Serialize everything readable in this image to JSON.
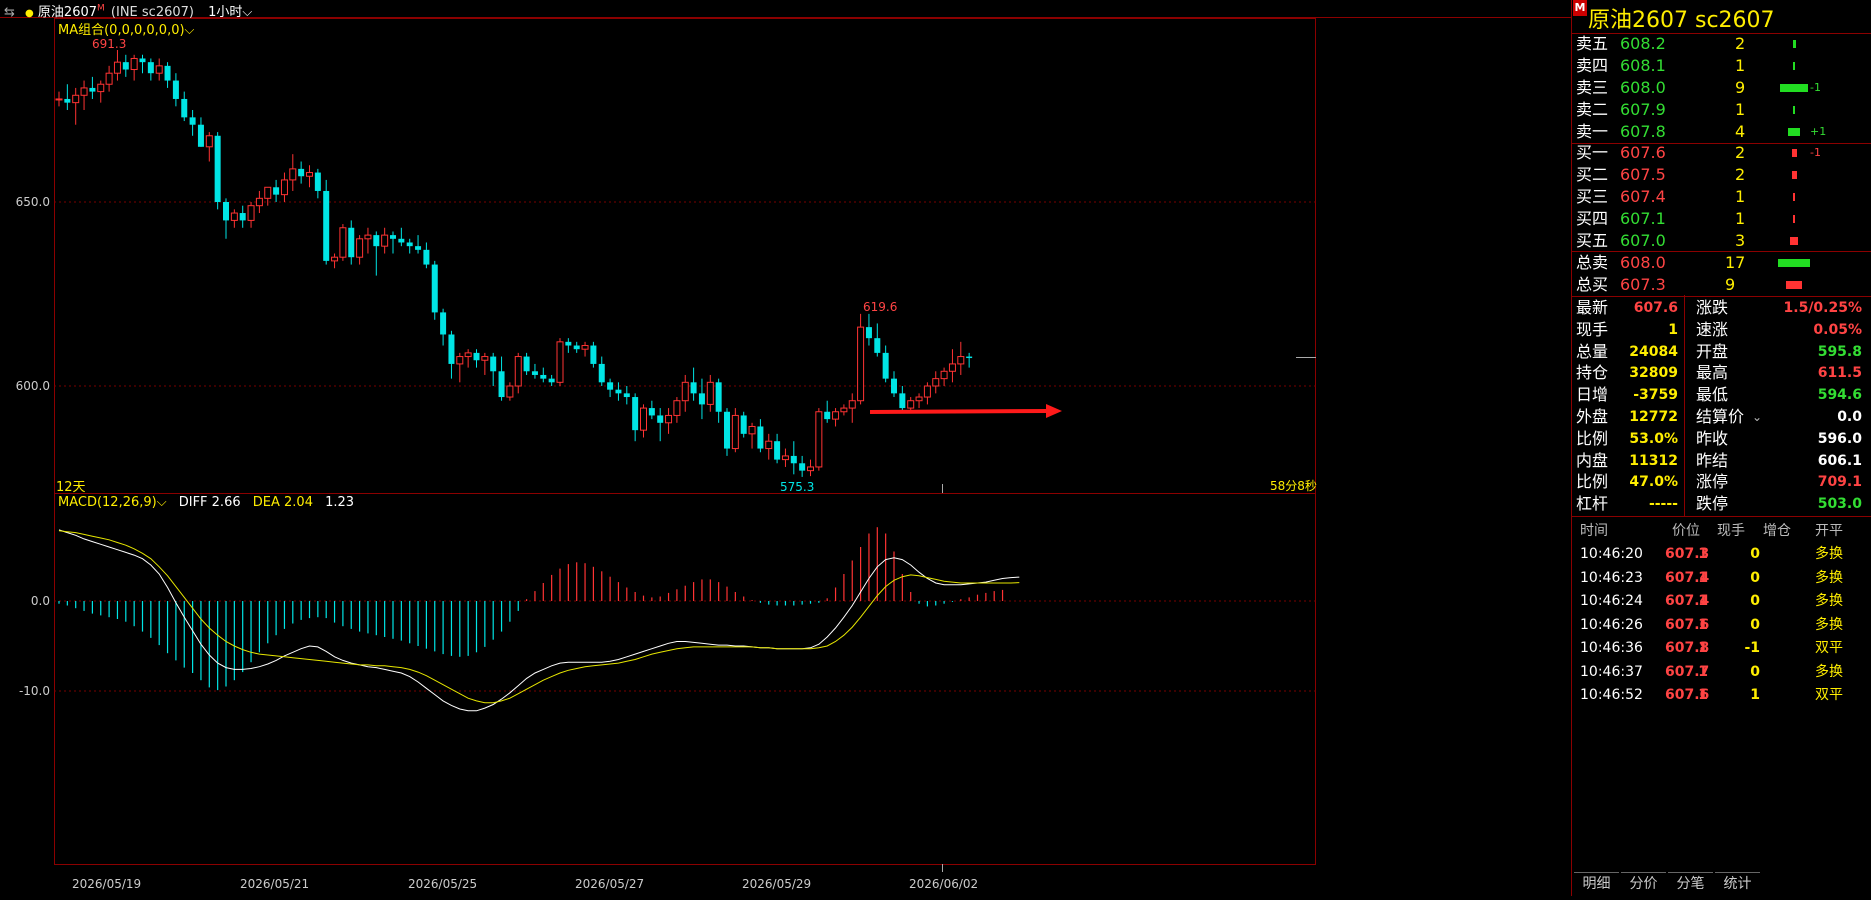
{
  "header": {
    "title": "原油2607",
    "marker": "M",
    "code": "(INE sc2607)",
    "period": "1小时",
    "ma_label": "MA组合(0,0,0,0,0,0)"
  },
  "chart_data": {
    "type": "candlestick",
    "y_ticks": [
      "650.0",
      "600.0"
    ],
    "x_labels": [
      "2026/05/19",
      "2026/05/21",
      "2026/05/25",
      "2026/05/27",
      "2026/05/29",
      "2026/06/02"
    ],
    "high_label": "691.3",
    "low_label": "575.3",
    "local_high_label": "619.6",
    "ohlc": [
      [
        678,
        680,
        676,
        678
      ],
      [
        678,
        682,
        675,
        677
      ],
      [
        677,
        681,
        671,
        679
      ],
      [
        679,
        683,
        675,
        681
      ],
      [
        681,
        684,
        678,
        680
      ],
      [
        680,
        683,
        677,
        682
      ],
      [
        682,
        687,
        680,
        685
      ],
      [
        685,
        691.3,
        683,
        688
      ],
      [
        688,
        690,
        684,
        686
      ],
      [
        686,
        690,
        683,
        689
      ],
      [
        689,
        690,
        685,
        688
      ],
      [
        688,
        689,
        683,
        685
      ],
      [
        685,
        689,
        683,
        687
      ],
      [
        687,
        688,
        681,
        683
      ],
      [
        683,
        685,
        676,
        678
      ],
      [
        678,
        680,
        672,
        673
      ],
      [
        673,
        675,
        668,
        671
      ],
      [
        671,
        673,
        665,
        665
      ],
      [
        665,
        669,
        661,
        668
      ],
      [
        668,
        669,
        648,
        650
      ],
      [
        650,
        651,
        640,
        645
      ],
      [
        645,
        648,
        643,
        647
      ],
      [
        647,
        649,
        643,
        645
      ],
      [
        645,
        650,
        643,
        649
      ],
      [
        649,
        653,
        647,
        651
      ],
      [
        651,
        654,
        649,
        654
      ],
      [
        654,
        656,
        650,
        652
      ],
      [
        652,
        658,
        650,
        656
      ],
      [
        656,
        663,
        653,
        659
      ],
      [
        659,
        661,
        655,
        657
      ],
      [
        657,
        660,
        654,
        658
      ],
      [
        658,
        659,
        651,
        653
      ],
      [
        653,
        656,
        633,
        634
      ],
      [
        634,
        636,
        632,
        635
      ],
      [
        635,
        644,
        634,
        643
      ],
      [
        643,
        645,
        633,
        635
      ],
      [
        635,
        641,
        633,
        640
      ],
      [
        640,
        643,
        636,
        641
      ],
      [
        641,
        642,
        630,
        638
      ],
      [
        638,
        643,
        636,
        641
      ],
      [
        641,
        642,
        636,
        640
      ],
      [
        640,
        643,
        638,
        639
      ],
      [
        639,
        640,
        636,
        638
      ],
      [
        638,
        641,
        636,
        637
      ],
      [
        637,
        639,
        632,
        633
      ],
      [
        633,
        634,
        618,
        620
      ],
      [
        620,
        621,
        611,
        614
      ],
      [
        614,
        615,
        602,
        606
      ],
      [
        606,
        609,
        601,
        608
      ],
      [
        608,
        610,
        605,
        609
      ],
      [
        609,
        610,
        605,
        607
      ],
      [
        607,
        609,
        603,
        608
      ],
      [
        608,
        609,
        600,
        604
      ],
      [
        604,
        608,
        596,
        597
      ],
      [
        597,
        601,
        596,
        600
      ],
      [
        600,
        609,
        598,
        608
      ],
      [
        608,
        609,
        603,
        604
      ],
      [
        604,
        606,
        602,
        603
      ],
      [
        603,
        605,
        601,
        602
      ],
      [
        602,
        603,
        600,
        601
      ],
      [
        601,
        613,
        600,
        612
      ],
      [
        612,
        613,
        609,
        611
      ],
      [
        611,
        612,
        609,
        610
      ],
      [
        610,
        612,
        608,
        611
      ],
      [
        611,
        612,
        605,
        606
      ],
      [
        606,
        608,
        600,
        601
      ],
      [
        601,
        602,
        597,
        599
      ],
      [
        599,
        601,
        596,
        598
      ],
      [
        598,
        600,
        595,
        597
      ],
      [
        597,
        598,
        585,
        588
      ],
      [
        588,
        595,
        586,
        594
      ],
      [
        594,
        596,
        591,
        592
      ],
      [
        592,
        594,
        585,
        590
      ],
      [
        590,
        594,
        587,
        592
      ],
      [
        592,
        597,
        590,
        596
      ],
      [
        596,
        603,
        593,
        601
      ],
      [
        601,
        605,
        596,
        598
      ],
      [
        598,
        602,
        591,
        595
      ],
      [
        595,
        603,
        593,
        601
      ],
      [
        601,
        602,
        590,
        593
      ],
      [
        593,
        594,
        581,
        583
      ],
      [
        583,
        594,
        582,
        592
      ],
      [
        592,
        593,
        586,
        587
      ],
      [
        587,
        590,
        583,
        589
      ],
      [
        589,
        591,
        582,
        583
      ],
      [
        583,
        587,
        580,
        585
      ],
      [
        585,
        587,
        579,
        580
      ],
      [
        580,
        583,
        578,
        581
      ],
      [
        581,
        585,
        576,
        579
      ],
      [
        579,
        581,
        575.3,
        577
      ],
      [
        577,
        580,
        575.5,
        578
      ],
      [
        578,
        594,
        577,
        593
      ],
      [
        593,
        596,
        590,
        591
      ],
      [
        591,
        594,
        589,
        593
      ],
      [
        593,
        595,
        592,
        594
      ],
      [
        594,
        598,
        590,
        596
      ],
      [
        596,
        619.6,
        595,
        616
      ],
      [
        616,
        619.6,
        611,
        613
      ],
      [
        613,
        617,
        608,
        609
      ],
      [
        609,
        611,
        601,
        602
      ],
      [
        602,
        604,
        597,
        598
      ],
      [
        598,
        600,
        593,
        594
      ],
      [
        594,
        597,
        593,
        596
      ],
      [
        596,
        598,
        594,
        597
      ],
      [
        597,
        601,
        595,
        600
      ],
      [
        600,
        604,
        598,
        602
      ],
      [
        602,
        605,
        600,
        604
      ],
      [
        604,
        610,
        601,
        606
      ],
      [
        606,
        612,
        603,
        608
      ],
      [
        608,
        609,
        605,
        607.6
      ]
    ],
    "macd_label": "MACD(12,26,9)",
    "diff_label": "DIFF 2.66",
    "dea_label": "DEA 2.04",
    "macd_value": "1.23",
    "macd_y_ticks": [
      "0.0",
      "-10.0"
    ],
    "macd_hist": [
      -0.3,
      -0.5,
      -0.8,
      -1.1,
      -1.4,
      -1.6,
      -1.8,
      -2.0,
      -2.3,
      -2.8,
      -3.4,
      -4.1,
      -4.9,
      -5.8,
      -6.6,
      -7.4,
      -8.0,
      -8.8,
      -9.6,
      -9.9,
      -9.5,
      -8.8,
      -7.9,
      -6.8,
      -5.7,
      -4.7,
      -3.8,
      -3.1,
      -2.5,
      -2.1,
      -1.9,
      -1.8,
      -1.9,
      -2.4,
      -2.8,
      -3.1,
      -3.4,
      -3.6,
      -3.8,
      -4.0,
      -4.2,
      -4.4,
      -4.7,
      -5.0,
      -5.3,
      -5.6,
      -5.9,
      -6.1,
      -6.2,
      -6.1,
      -5.7,
      -5.1,
      -4.3,
      -3.4,
      -2.3,
      -1.1,
      0.2,
      1.1,
      2.0,
      2.9,
      3.6,
      4.1,
      4.3,
      4.2,
      3.8,
      3.3,
      2.7,
      2.1,
      1.5,
      1.0,
      0.6,
      0.4,
      0.5,
      0.9,
      1.3,
      1.7,
      2.1,
      2.4,
      2.4,
      2.1,
      1.6,
      1.0,
      0.5,
      0.1,
      -0.2,
      -0.4,
      -0.5,
      -0.5,
      -0.5,
      -0.4,
      -0.3,
      -0.2,
      0.3,
      1.5,
      3.0,
      4.5,
      6.0,
      7.5,
      8.2,
      7.5,
      5.5,
      3.0,
      1.0,
      -0.3,
      -0.6,
      -0.5,
      -0.3,
      -0.1,
      0.2,
      0.4,
      0.7,
      0.9,
      1.1,
      1.23
    ],
    "macd_diff": [
      7.9,
      7.6,
      7.3,
      6.9,
      6.6,
      6.3,
      6.0,
      5.7,
      5.4,
      5.1,
      4.7,
      4.0,
      3.0,
      1.5,
      -0.2,
      -1.8,
      -3.3,
      -4.8,
      -6.0,
      -6.9,
      -7.4,
      -7.6,
      -7.6,
      -7.5,
      -7.3,
      -7.0,
      -6.6,
      -6.1,
      -5.7,
      -5.3,
      -5.0,
      -5.1,
      -5.6,
      -6.2,
      -6.6,
      -6.9,
      -7.1,
      -7.3,
      -7.4,
      -7.6,
      -7.8,
      -8.0,
      -8.4,
      -9.0,
      -9.7,
      -10.4,
      -11.1,
      -11.6,
      -12.0,
      -12.2,
      -12.2,
      -11.9,
      -11.5,
      -10.9,
      -10.2,
      -9.4,
      -8.6,
      -8.0,
      -7.6,
      -7.2,
      -6.9,
      -6.8,
      -6.8,
      -6.8,
      -6.8,
      -6.8,
      -6.7,
      -6.5,
      -6.2,
      -5.9,
      -5.6,
      -5.3,
      -5.0,
      -4.7,
      -4.5,
      -4.5,
      -4.6,
      -4.7,
      -4.8,
      -4.9,
      -4.9,
      -5.0,
      -5.0,
      -5.1,
      -5.2,
      -5.2,
      -5.3,
      -5.3,
      -5.3,
      -5.3,
      -5.2,
      -4.8,
      -4.0,
      -3.0,
      -1.8,
      -0.5,
      1.0,
      2.5,
      3.8,
      4.6,
      4.8,
      4.6,
      4.0,
      3.2,
      2.5,
      2.0,
      1.8,
      1.8,
      1.8,
      1.9,
      2.0,
      2.1,
      2.3,
      2.5,
      2.6,
      2.66
    ],
    "macd_dea": [
      7.8,
      7.7,
      7.6,
      7.4,
      7.2,
      7.0,
      6.8,
      6.5,
      6.2,
      5.8,
      5.3,
      4.7,
      3.8,
      2.8,
      1.6,
      0.4,
      -0.8,
      -2.0,
      -3.0,
      -3.8,
      -4.5,
      -5.0,
      -5.4,
      -5.7,
      -5.9,
      -6.0,
      -6.1,
      -6.2,
      -6.3,
      -6.4,
      -6.5,
      -6.6,
      -6.7,
      -6.8,
      -6.9,
      -7.0,
      -7.1,
      -7.1,
      -7.2,
      -7.2,
      -7.3,
      -7.4,
      -7.6,
      -7.9,
      -8.3,
      -8.8,
      -9.3,
      -9.8,
      -10.3,
      -10.8,
      -11.1,
      -11.3,
      -11.3,
      -11.1,
      -10.8,
      -10.3,
      -9.8,
      -9.3,
      -8.8,
      -8.4,
      -8.0,
      -7.7,
      -7.5,
      -7.3,
      -7.2,
      -7.1,
      -7.0,
      -6.9,
      -6.7,
      -6.5,
      -6.2,
      -5.9,
      -5.7,
      -5.5,
      -5.3,
      -5.2,
      -5.1,
      -5.1,
      -5.1,
      -5.1,
      -5.1,
      -5.1,
      -5.1,
      -5.1,
      -5.2,
      -5.2,
      -5.3,
      -5.3,
      -5.3,
      -5.3,
      -5.3,
      -5.2,
      -5.0,
      -4.5,
      -3.8,
      -2.9,
      -1.8,
      -0.6,
      0.6,
      1.6,
      2.3,
      2.7,
      2.9,
      2.8,
      2.6,
      2.4,
      2.2,
      2.1,
      2.0,
      2.0,
      2.0,
      2.0,
      2.0,
      2.0,
      2.0,
      2.04
    ]
  },
  "labels": {
    "days": "12天",
    "countdown": "58分8秒"
  },
  "quote": {
    "title": "原油2607 sc2607",
    "title_marker": "M",
    "asks": [
      {
        "label": "卖五",
        "price": "608.2",
        "vol": "2",
        "bar": 3,
        "change": ""
      },
      {
        "label": "卖四",
        "price": "608.1",
        "vol": "1",
        "bar": 2,
        "change": ""
      },
      {
        "label": "卖三",
        "price": "608.0",
        "vol": "9",
        "bar": 28,
        "change": "-1"
      },
      {
        "label": "卖二",
        "price": "607.9",
        "vol": "1",
        "bar": 2,
        "change": ""
      },
      {
        "label": "卖一",
        "price": "607.8",
        "vol": "4",
        "bar": 12,
        "change": "+1"
      }
    ],
    "bids": [
      {
        "label": "买一",
        "price": "607.6",
        "vol": "2",
        "bar": 5,
        "change": "-1",
        "color": "red"
      },
      {
        "label": "买二",
        "price": "607.5",
        "vol": "2",
        "bar": 5,
        "change": "",
        "color": "red"
      },
      {
        "label": "买三",
        "price": "607.4",
        "vol": "1",
        "bar": 2,
        "change": "",
        "color": "red"
      },
      {
        "label": "买四",
        "price": "607.1",
        "vol": "1",
        "bar": 2,
        "change": "",
        "color": "green"
      },
      {
        "label": "买五",
        "price": "607.0",
        "vol": "3",
        "bar": 8,
        "change": "",
        "color": "green"
      }
    ],
    "totals": [
      {
        "label": "总卖",
        "price": "608.0",
        "vol": "17",
        "bar": 32,
        "color": "red",
        "barcolor": "green"
      },
      {
        "label": "总买",
        "price": "607.3",
        "vol": "9",
        "bar": 16,
        "color": "red",
        "barcolor": "red"
      }
    ],
    "stats_left": [
      {
        "label": "最新",
        "value": "607.6",
        "color": "red"
      },
      {
        "label": "现手",
        "value": "1",
        "color": "yellow"
      },
      {
        "label": "总量",
        "value": "24084",
        "color": "yellow"
      },
      {
        "label": "持仓",
        "value": "32809",
        "color": "yellow"
      },
      {
        "label": "日增",
        "value": "-3759",
        "color": "yellow"
      },
      {
        "label": "外盘",
        "value": "12772",
        "color": "yellow"
      },
      {
        "label": "比例",
        "value": "53.0%",
        "color": "yellow"
      },
      {
        "label": "内盘",
        "value": "11312",
        "color": "yellow"
      },
      {
        "label": "比例",
        "value": "47.0%",
        "color": "yellow"
      },
      {
        "label": "杠杆",
        "value": "-----",
        "color": "yellow"
      }
    ],
    "stats_right": [
      {
        "label": "涨跌",
        "value": "1.5/0.25%",
        "color": "red"
      },
      {
        "label": "速涨",
        "value": "0.05%",
        "color": "red"
      },
      {
        "label": "开盘",
        "value": "595.8",
        "color": "green"
      },
      {
        "label": "最高",
        "value": "611.5",
        "color": "red"
      },
      {
        "label": "最低",
        "value": "594.6",
        "color": "green"
      },
      {
        "label": "结算价",
        "value": "0.0",
        "color": "white"
      },
      {
        "label": "昨收",
        "value": "596.0",
        "color": "white"
      },
      {
        "label": "昨结",
        "value": "606.1",
        "color": "white"
      },
      {
        "label": "涨停",
        "value": "709.1",
        "color": "red"
      },
      {
        "label": "跌停",
        "value": "503.0",
        "color": "green"
      }
    ],
    "ticks_header": {
      "time": "时间",
      "price": "价位",
      "hand": "现手",
      "inc": "增仓",
      "kind": "开平"
    },
    "ticks": [
      {
        "time": "10:46:20",
        "price": "607.3",
        "hand": "1",
        "inc": "0",
        "kind": "多换"
      },
      {
        "time": "10:46:23",
        "price": "607.4",
        "hand": "1",
        "inc": "0",
        "kind": "多换"
      },
      {
        "time": "10:46:24",
        "price": "607.4",
        "hand": "1",
        "inc": "0",
        "kind": "多换"
      },
      {
        "time": "10:46:26",
        "price": "607.6",
        "hand": "1",
        "inc": "0",
        "kind": "多换"
      },
      {
        "time": "10:46:36",
        "price": "607.8",
        "hand": "1",
        "inc": "-1",
        "kind": "双平"
      },
      {
        "time": "10:46:37",
        "price": "607.7",
        "hand": "1",
        "inc": "0",
        "kind": "多换"
      },
      {
        "time": "10:46:52",
        "price": "607.6",
        "hand": "1",
        "inc": "1",
        "kind": "双平"
      }
    ],
    "tabs": [
      "明细",
      "分价",
      "分笔",
      "统计"
    ]
  },
  "colors": {
    "up": "#ff3333",
    "down": "#00e5e5",
    "frame": "#8b0000",
    "diff": "#ffffff",
    "dea": "#e6e600",
    "arrow": "#ff1a1a"
  }
}
